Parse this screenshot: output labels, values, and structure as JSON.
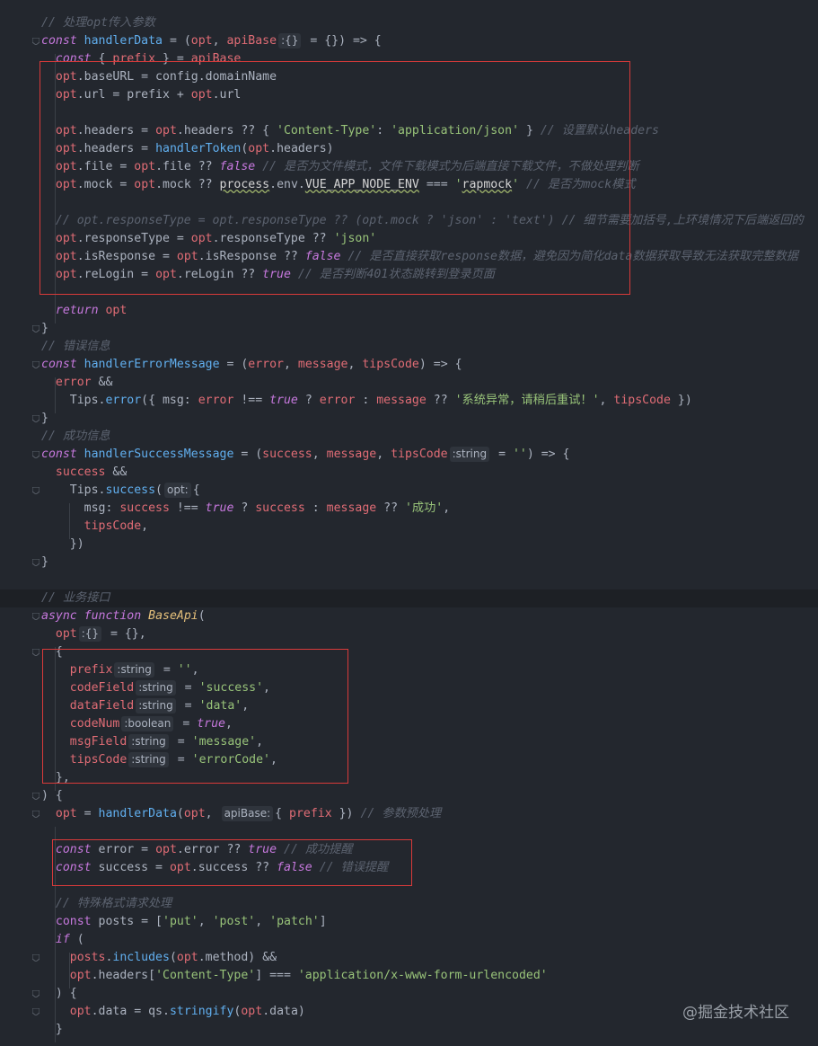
{
  "watermark": "@掘金技术社区",
  "lines": [
    {
      "tokens": [
        [
          "c",
          "// 处理opt传入参数"
        ]
      ]
    },
    {
      "tokens": [
        [
          "k",
          "const"
        ],
        [
          "p",
          " "
        ],
        [
          "f",
          "handlerData"
        ],
        [
          "p",
          " = ("
        ],
        [
          "v",
          "opt"
        ],
        [
          "p",
          ", "
        ],
        [
          "v",
          "apiBase"
        ],
        [
          "hint",
          ":{}"
        ],
        [
          "p",
          " = {}) => {"
        ]
      ]
    },
    {
      "tokens": [
        [
          "p",
          "  "
        ],
        [
          "k",
          "const"
        ],
        [
          "p",
          " { "
        ],
        [
          "v",
          "prefix"
        ],
        [
          "p",
          " } = "
        ],
        [
          "v",
          "apiBase"
        ]
      ]
    },
    {
      "tokens": [
        [
          "p",
          "  "
        ],
        [
          "v",
          "opt"
        ],
        [
          "p",
          ".baseURL = config.domainName"
        ]
      ]
    },
    {
      "tokens": [
        [
          "p",
          "  "
        ],
        [
          "v",
          "opt"
        ],
        [
          "p",
          ".url = prefix + "
        ],
        [
          "v",
          "opt"
        ],
        [
          "p",
          ".url"
        ]
      ]
    },
    {
      "tokens": []
    },
    {
      "tokens": [
        [
          "p",
          "  "
        ],
        [
          "v",
          "opt"
        ],
        [
          "p",
          ".headers = "
        ],
        [
          "v",
          "opt"
        ],
        [
          "p",
          ".headers ?? { "
        ],
        [
          "s",
          "'Content-Type'"
        ],
        [
          "p",
          ": "
        ],
        [
          "s",
          "'application/json'"
        ],
        [
          "p",
          " } "
        ],
        [
          "c",
          "// 设置默认headers"
        ]
      ]
    },
    {
      "tokens": [
        [
          "p",
          "  "
        ],
        [
          "v",
          "opt"
        ],
        [
          "p",
          ".headers = "
        ],
        [
          "f",
          "handlerToken"
        ],
        [
          "p",
          "("
        ],
        [
          "v",
          "opt"
        ],
        [
          "p",
          ".headers)"
        ]
      ]
    },
    {
      "tokens": [
        [
          "p",
          "  "
        ],
        [
          "v",
          "opt"
        ],
        [
          "p",
          ".file = "
        ],
        [
          "v",
          "opt"
        ],
        [
          "p",
          ".file ?? "
        ],
        [
          "b",
          "false"
        ],
        [
          "p",
          " "
        ],
        [
          "c",
          "// 是否为文件模式，文件下载模式为后端直接下载文件，不做处理判断"
        ]
      ]
    },
    {
      "tokens": [
        [
          "p",
          "  "
        ],
        [
          "v",
          "opt"
        ],
        [
          "p",
          ".mock = "
        ],
        [
          "v",
          "opt"
        ],
        [
          "p",
          ".mock ?? "
        ],
        [
          "ul",
          "process"
        ],
        [
          "p",
          ".env."
        ],
        [
          "ul",
          "VUE_APP_NODE_ENV"
        ],
        [
          "p",
          " === "
        ],
        [
          "s",
          "'"
        ],
        [
          "ul",
          "rapmock"
        ],
        [
          "s",
          "'"
        ],
        [
          "p",
          " "
        ],
        [
          "c",
          "// 是否为mock模式"
        ]
      ]
    },
    {
      "tokens": []
    },
    {
      "tokens": [
        [
          "p",
          "  "
        ],
        [
          "c",
          "// opt.responseType = opt.responseType ?? (opt.mock ? 'json' : 'text') // 细节需要加括号,上环境情况下后端返回的"
        ]
      ]
    },
    {
      "tokens": [
        [
          "p",
          "  "
        ],
        [
          "v",
          "opt"
        ],
        [
          "p",
          ".responseType = "
        ],
        [
          "v",
          "opt"
        ],
        [
          "p",
          ".responseType ?? "
        ],
        [
          "s",
          "'json'"
        ]
      ]
    },
    {
      "tokens": [
        [
          "p",
          "  "
        ],
        [
          "v",
          "opt"
        ],
        [
          "p",
          ".isResponse = "
        ],
        [
          "v",
          "opt"
        ],
        [
          "p",
          ".isResponse ?? "
        ],
        [
          "b",
          "false"
        ],
        [
          "p",
          " "
        ],
        [
          "c",
          "// 是否直接获取response数据，避免因为简化data数据获取导致无法获取完整数据"
        ]
      ]
    },
    {
      "tokens": [
        [
          "p",
          "  "
        ],
        [
          "v",
          "opt"
        ],
        [
          "p",
          ".reLogin = "
        ],
        [
          "v",
          "opt"
        ],
        [
          "p",
          ".reLogin ?? "
        ],
        [
          "b",
          "true"
        ],
        [
          "p",
          " "
        ],
        [
          "c",
          "// 是否判断401状态跳转到登录页面"
        ]
      ]
    },
    {
      "tokens": []
    },
    {
      "tokens": [
        [
          "p",
          "  "
        ],
        [
          "k",
          "return"
        ],
        [
          "p",
          " "
        ],
        [
          "v",
          "opt"
        ]
      ]
    },
    {
      "tokens": [
        [
          "p",
          "}"
        ]
      ]
    },
    {
      "tokens": [
        [
          "c",
          "// 错误信息"
        ]
      ]
    },
    {
      "tokens": [
        [
          "k",
          "const"
        ],
        [
          "p",
          " "
        ],
        [
          "f",
          "handlerErrorMessage"
        ],
        [
          "p",
          " = ("
        ],
        [
          "v",
          "error"
        ],
        [
          "p",
          ", "
        ],
        [
          "v",
          "message"
        ],
        [
          "p",
          ", "
        ],
        [
          "v",
          "tipsCode"
        ],
        [
          "p",
          ") => {"
        ]
      ]
    },
    {
      "tokens": [
        [
          "p",
          "  "
        ],
        [
          "v",
          "error"
        ],
        [
          "p",
          " &&"
        ]
      ]
    },
    {
      "tokens": [
        [
          "p",
          "    Tips."
        ],
        [
          "f",
          "error"
        ],
        [
          "p",
          "({ msg: "
        ],
        [
          "v",
          "error"
        ],
        [
          "p",
          " !== "
        ],
        [
          "b",
          "true"
        ],
        [
          "p",
          " ? "
        ],
        [
          "v",
          "error"
        ],
        [
          "p",
          " : "
        ],
        [
          "v",
          "message"
        ],
        [
          "p",
          " ?? "
        ],
        [
          "s",
          "'系统异常，请稍后重试！'"
        ],
        [
          "p",
          ", "
        ],
        [
          "v",
          "tipsCode"
        ],
        [
          "p",
          " })"
        ]
      ]
    },
    {
      "tokens": [
        [
          "p",
          "}"
        ]
      ]
    },
    {
      "tokens": [
        [
          "c",
          "// 成功信息"
        ]
      ]
    },
    {
      "tokens": [
        [
          "k",
          "const"
        ],
        [
          "p",
          " "
        ],
        [
          "f",
          "handlerSuccessMessage"
        ],
        [
          "p",
          " = ("
        ],
        [
          "v",
          "success"
        ],
        [
          "p",
          ", "
        ],
        [
          "v",
          "message"
        ],
        [
          "p",
          ", "
        ],
        [
          "v",
          "tipsCode"
        ],
        [
          "hint",
          ":string"
        ],
        [
          "p",
          " = "
        ],
        [
          "s",
          "''"
        ],
        [
          "p",
          ") => {"
        ]
      ]
    },
    {
      "tokens": [
        [
          "p",
          "  "
        ],
        [
          "v",
          "success"
        ],
        [
          "p",
          " &&"
        ]
      ]
    },
    {
      "tokens": [
        [
          "p",
          "    Tips."
        ],
        [
          "f",
          "success"
        ],
        [
          "p",
          "("
        ],
        [
          "hint",
          "opt:"
        ],
        [
          "p",
          "{"
        ]
      ]
    },
    {
      "tokens": [
        [
          "p",
          "      msg: "
        ],
        [
          "v",
          "success"
        ],
        [
          "p",
          " !== "
        ],
        [
          "b",
          "true"
        ],
        [
          "p",
          " ? "
        ],
        [
          "v",
          "success"
        ],
        [
          "p",
          " : "
        ],
        [
          "v",
          "message"
        ],
        [
          "p",
          " ?? "
        ],
        [
          "s",
          "'成功'"
        ],
        [
          "p",
          ","
        ]
      ]
    },
    {
      "tokens": [
        [
          "p",
          "      "
        ],
        [
          "v",
          "tipsCode"
        ],
        [
          "p",
          ","
        ]
      ]
    },
    {
      "tokens": [
        [
          "p",
          "    })"
        ]
      ]
    },
    {
      "tokens": [
        [
          "p",
          "}"
        ]
      ]
    },
    {
      "tokens": []
    },
    {
      "tokens": [
        [
          "c",
          "// 业务接口"
        ]
      ]
    },
    {
      "tokens": [
        [
          "k",
          "async"
        ],
        [
          "p",
          " "
        ],
        [
          "k",
          "function"
        ],
        [
          "p",
          " "
        ],
        [
          "t",
          "BaseApi"
        ],
        [
          "p",
          "("
        ]
      ]
    },
    {
      "tokens": [
        [
          "p",
          "  "
        ],
        [
          "v",
          "opt"
        ],
        [
          "hint",
          ":{}"
        ],
        [
          "p",
          " = {},"
        ]
      ]
    },
    {
      "tokens": [
        [
          "p",
          "  {"
        ]
      ]
    },
    {
      "tokens": [
        [
          "p",
          "    "
        ],
        [
          "v",
          "prefix"
        ],
        [
          "hint",
          ":string"
        ],
        [
          "p",
          " = "
        ],
        [
          "s",
          "''"
        ],
        [
          "p",
          ","
        ]
      ]
    },
    {
      "tokens": [
        [
          "p",
          "    "
        ],
        [
          "v",
          "codeField"
        ],
        [
          "hint",
          ":string"
        ],
        [
          "p",
          " = "
        ],
        [
          "s",
          "'success'"
        ],
        [
          "p",
          ","
        ]
      ]
    },
    {
      "tokens": [
        [
          "p",
          "    "
        ],
        [
          "v",
          "dataField"
        ],
        [
          "hint",
          ":string"
        ],
        [
          "p",
          " = "
        ],
        [
          "s",
          "'data'"
        ],
        [
          "p",
          ","
        ]
      ]
    },
    {
      "tokens": [
        [
          "p",
          "    "
        ],
        [
          "v",
          "codeNum"
        ],
        [
          "hint",
          ":boolean"
        ],
        [
          "p",
          " = "
        ],
        [
          "b",
          "true"
        ],
        [
          "p",
          ","
        ]
      ]
    },
    {
      "tokens": [
        [
          "p",
          "    "
        ],
        [
          "v",
          "msgField"
        ],
        [
          "hint",
          ":string"
        ],
        [
          "p",
          " = "
        ],
        [
          "s",
          "'message'"
        ],
        [
          "p",
          ","
        ]
      ]
    },
    {
      "tokens": [
        [
          "p",
          "    "
        ],
        [
          "v",
          "tipsCode"
        ],
        [
          "hint",
          ":string"
        ],
        [
          "p",
          " = "
        ],
        [
          "s",
          "'errorCode'"
        ],
        [
          "p",
          ","
        ]
      ]
    },
    {
      "tokens": [
        [
          "p",
          "  },"
        ]
      ]
    },
    {
      "tokens": [
        [
          "p",
          ") {"
        ]
      ]
    },
    {
      "tokens": [
        [
          "p",
          "  "
        ],
        [
          "v",
          "opt"
        ],
        [
          "p",
          " = "
        ],
        [
          "f",
          "handlerData"
        ],
        [
          "p",
          "("
        ],
        [
          "v",
          "opt"
        ],
        [
          "p",
          ", "
        ],
        [
          "hint",
          "apiBase:"
        ],
        [
          "p",
          "{ "
        ],
        [
          "v",
          "prefix"
        ],
        [
          "p",
          " }) "
        ],
        [
          "c",
          "// 参数预处理"
        ]
      ]
    },
    {
      "tokens": []
    },
    {
      "tokens": [
        [
          "p",
          "  "
        ],
        [
          "k",
          "const"
        ],
        [
          "p",
          " error = "
        ],
        [
          "v",
          "opt"
        ],
        [
          "p",
          ".error ?? "
        ],
        [
          "b",
          "true"
        ],
        [
          "p",
          " "
        ],
        [
          "c",
          "// 成功提醒"
        ]
      ]
    },
    {
      "tokens": [
        [
          "p",
          "  "
        ],
        [
          "k",
          "const"
        ],
        [
          "p",
          " success = "
        ],
        [
          "v",
          "opt"
        ],
        [
          "p",
          ".success ?? "
        ],
        [
          "b",
          "false"
        ],
        [
          "p",
          " "
        ],
        [
          "c",
          "// 错误提醒"
        ]
      ]
    },
    {
      "tokens": []
    },
    {
      "tokens": [
        [
          "p",
          "  "
        ],
        [
          "c",
          "// 特殊格式请求处理"
        ]
      ]
    },
    {
      "tokens": [
        [
          "p",
          "  "
        ],
        [
          "kw",
          "const"
        ],
        [
          "p",
          " posts = ["
        ],
        [
          "s",
          "'put'"
        ],
        [
          "p",
          ", "
        ],
        [
          "s",
          "'post'"
        ],
        [
          "p",
          ", "
        ],
        [
          "s",
          "'patch'"
        ],
        [
          "p",
          "]"
        ]
      ]
    },
    {
      "tokens": [
        [
          "p",
          "  "
        ],
        [
          "k",
          "if"
        ],
        [
          "p",
          " ("
        ]
      ]
    },
    {
      "tokens": [
        [
          "p",
          "    "
        ],
        [
          "v",
          "posts"
        ],
        [
          "p",
          "."
        ],
        [
          "f",
          "includes"
        ],
        [
          "p",
          "("
        ],
        [
          "v",
          "opt"
        ],
        [
          "p",
          ".method) &&"
        ]
      ]
    },
    {
      "tokens": [
        [
          "p",
          "    "
        ],
        [
          "v",
          "opt"
        ],
        [
          "p",
          ".headers["
        ],
        [
          "s",
          "'Content-Type'"
        ],
        [
          "p",
          "] === "
        ],
        [
          "s",
          "'application/x-www-form-urlencoded'"
        ]
      ]
    },
    {
      "tokens": [
        [
          "p",
          "  ) {"
        ]
      ]
    },
    {
      "tokens": [
        [
          "p",
          "    "
        ],
        [
          "v",
          "opt"
        ],
        [
          "p",
          ".data = qs."
        ],
        [
          "f",
          "stringify"
        ],
        [
          "p",
          "("
        ],
        [
          "v",
          "opt"
        ],
        [
          "p",
          ".data)"
        ]
      ]
    },
    {
      "tokens": [
        [
          "p",
          "  }"
        ]
      ]
    }
  ]
}
